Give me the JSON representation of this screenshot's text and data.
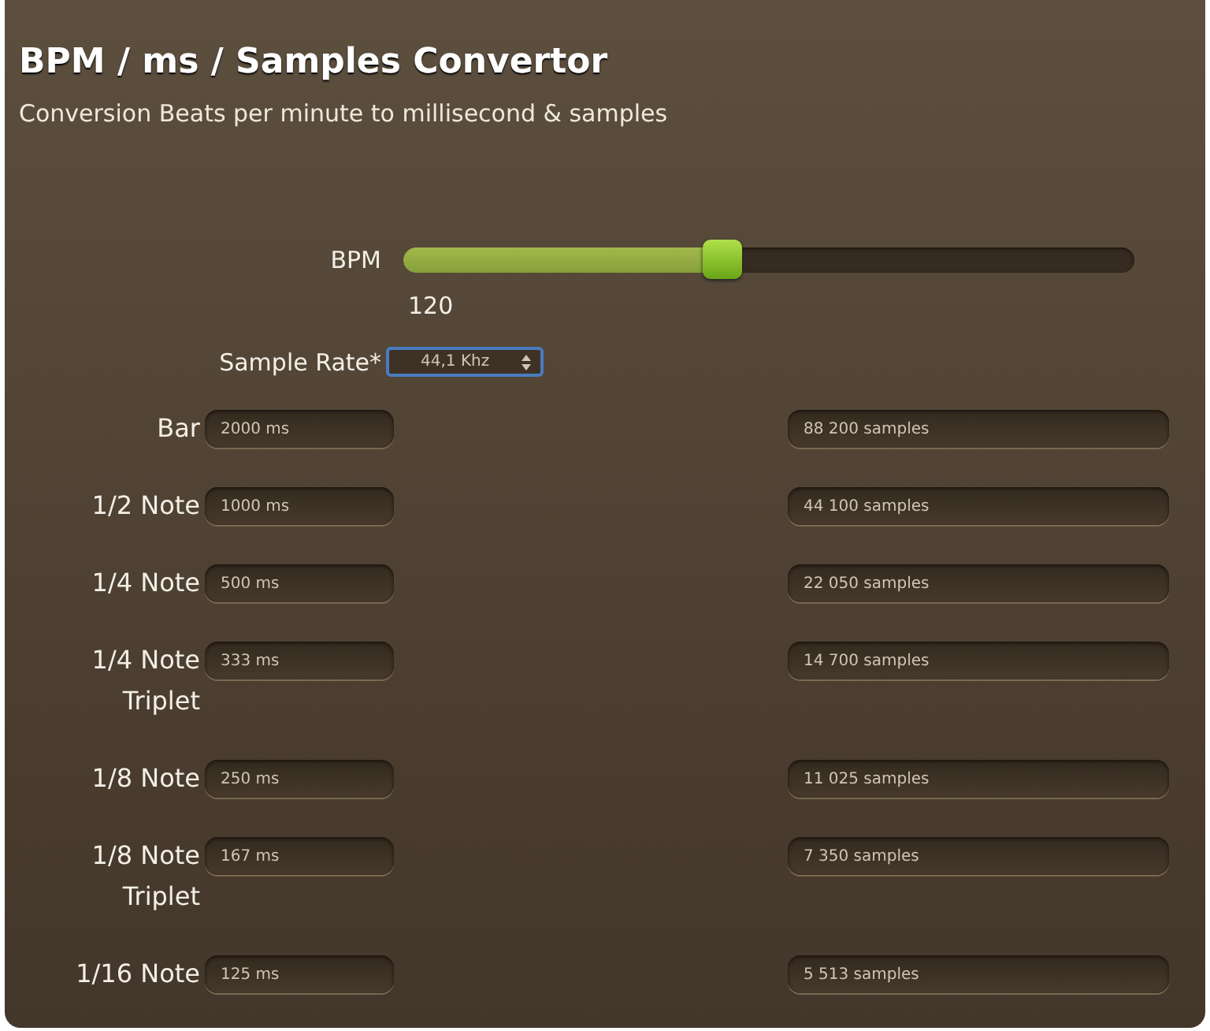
{
  "title": "BPM / ms / Samples Convertor",
  "subtitle": "Conversion Beats per minute to millisecond & samples",
  "bpm": {
    "label": "BPM",
    "level": 0.435,
    "reading": "120"
  },
  "sample_rate": {
    "label": "Sample Rate*",
    "value": "44,1 Khz"
  },
  "rows": [
    {
      "label": "Bar",
      "ms": "2000 ms",
      "samples": "88 200 samples"
    },
    {
      "label": "1/2 Note",
      "ms": "1000 ms",
      "samples": "44 100 samples"
    },
    {
      "label": "1/4 Note",
      "ms": "500 ms",
      "samples": "22 050 samples"
    },
    {
      "label": "1/4 Note Triplet",
      "ms": "333 ms",
      "samples": "14 700 samples"
    },
    {
      "label": "1/8 Note",
      "ms": "250 ms",
      "samples": "11 025 samples"
    },
    {
      "label": "1/8 Note Triplet",
      "ms": "167 ms",
      "samples": "7 350 samples"
    },
    {
      "label": "1/16 Note",
      "ms": "125 ms",
      "samples": "5 513 samples"
    }
  ]
}
